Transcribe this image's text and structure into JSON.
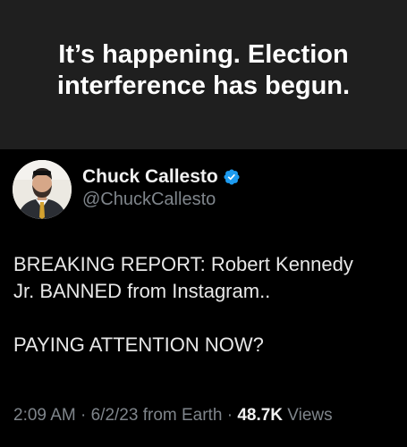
{
  "caption": {
    "line1": "It’s happening. Election",
    "line2": "interference has begun."
  },
  "tweet": {
    "author": {
      "display_name": "Chuck Callesto",
      "handle": "@ChuckCallesto",
      "verified_color": "#1d9bf0"
    },
    "text": {
      "line1": "BREAKING REPORT: Robert Kennedy",
      "line2": "Jr. BANNED from Instagram..",
      "line3": "PAYING ATTENTION NOW?"
    },
    "meta": {
      "time": "2:09 AM",
      "sep1": " · ",
      "date": "6/2/23",
      "source": " from Earth",
      "sep2": " · ",
      "views_count": "48.7K",
      "views_label": " Views"
    }
  },
  "icons": {
    "verified": "verified-badge-icon",
    "avatar": "profile-photo"
  }
}
